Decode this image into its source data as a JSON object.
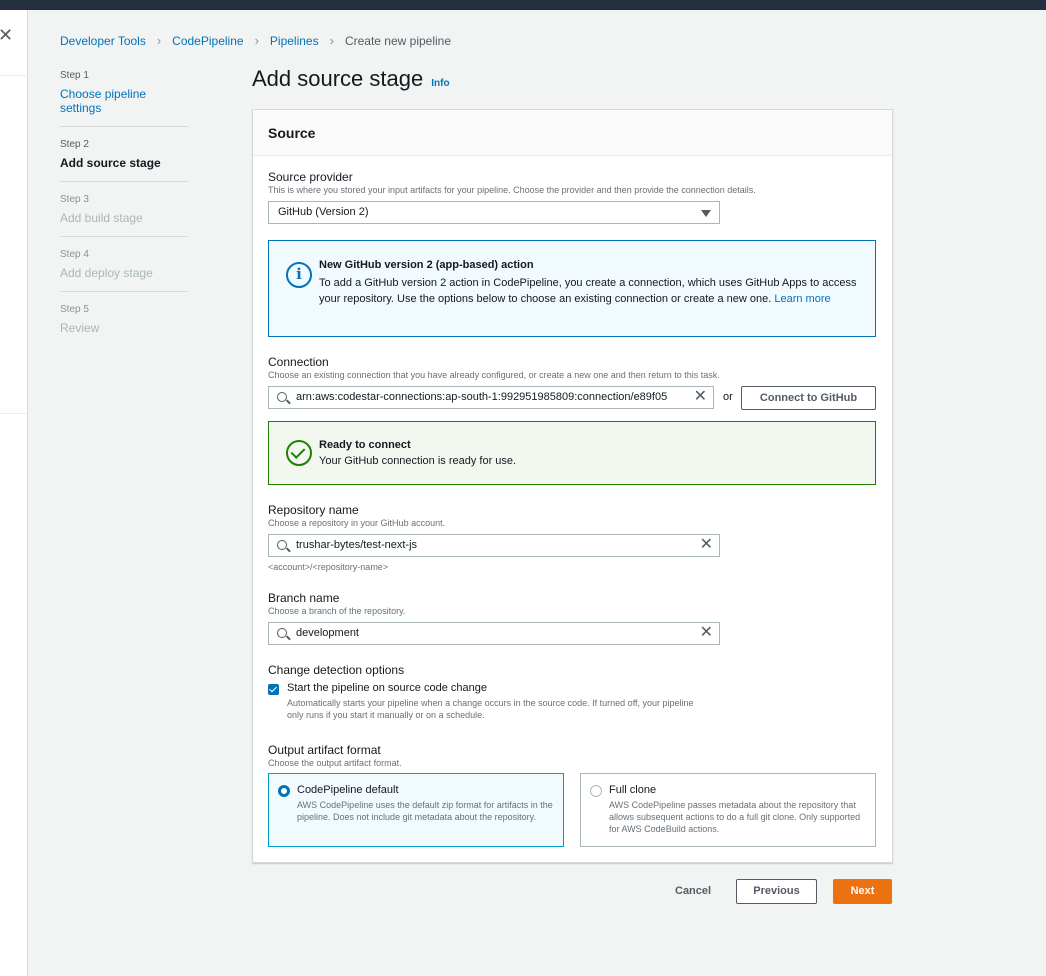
{
  "breadcrumb": {
    "items": [
      "Developer Tools",
      "CodePipeline",
      "Pipelines"
    ],
    "current": "Create new pipeline"
  },
  "steps": [
    {
      "num": "Step 1",
      "label": "Choose pipeline settings",
      "state": "link"
    },
    {
      "num": "Step 2",
      "label": "Add source stage",
      "state": "active"
    },
    {
      "num": "Step 3",
      "label": "Add build stage",
      "state": "disabled"
    },
    {
      "num": "Step 4",
      "label": "Add deploy stage",
      "state": "disabled"
    },
    {
      "num": "Step 5",
      "label": "Review",
      "state": "disabled"
    }
  ],
  "page": {
    "title": "Add source stage",
    "info_link": "Info"
  },
  "panel": {
    "title": "Source",
    "source_provider": {
      "label": "Source provider",
      "description": "This is where you stored your input artifacts for your pipeline. Choose the provider and then provide the connection details.",
      "value": "GitHub (Version 2)"
    },
    "info_alert": {
      "title": "New GitHub version 2 (app-based) action",
      "body": "To add a GitHub version 2 action in CodePipeline, you create a connection, which uses GitHub Apps to access your repository. Use the options below to choose an existing connection or create a new one.",
      "link": "Learn more"
    },
    "connection": {
      "label": "Connection",
      "description": "Choose an existing connection that you have already configured, or create a new one and then return to this task.",
      "value": "arn:aws:codestar-connections:ap-south-1:992951985809:connection/e89f05",
      "or": "or",
      "button": "Connect to GitHub"
    },
    "success_alert": {
      "title": "Ready to connect",
      "body": "Your GitHub connection is ready for use."
    },
    "repository": {
      "label": "Repository name",
      "description": "Choose a repository in your GitHub account.",
      "value": "trushar-bytes/test-next-js",
      "hint": "<account>/<repository-name>"
    },
    "branch": {
      "label": "Branch name",
      "description": "Choose a branch of the repository.",
      "value": "development"
    },
    "change_detection": {
      "label": "Change detection options",
      "checkbox_label": "Start the pipeline on source code change",
      "checkbox_desc": "Automatically starts your pipeline when a change occurs in the source code. If turned off, your pipeline only runs if you start it manually or on a schedule.",
      "checked": true
    },
    "output_format": {
      "label": "Output artifact format",
      "description": "Choose the output artifact format.",
      "options": [
        {
          "title": "CodePipeline default",
          "desc": "AWS CodePipeline uses the default zip format for artifacts in the pipeline. Does not include git metadata about the repository.",
          "selected": true
        },
        {
          "title": "Full clone",
          "desc": "AWS CodePipeline passes metadata about the repository that allows subsequent actions to do a full git clone. Only supported for AWS CodeBuild actions.",
          "selected": false
        }
      ]
    }
  },
  "footer": {
    "cancel": "Cancel",
    "previous": "Previous",
    "next": "Next"
  },
  "colors": {
    "link": "#0073bb",
    "primary": "#ec7211",
    "success": "#1d8102",
    "header": "#232f3e"
  }
}
